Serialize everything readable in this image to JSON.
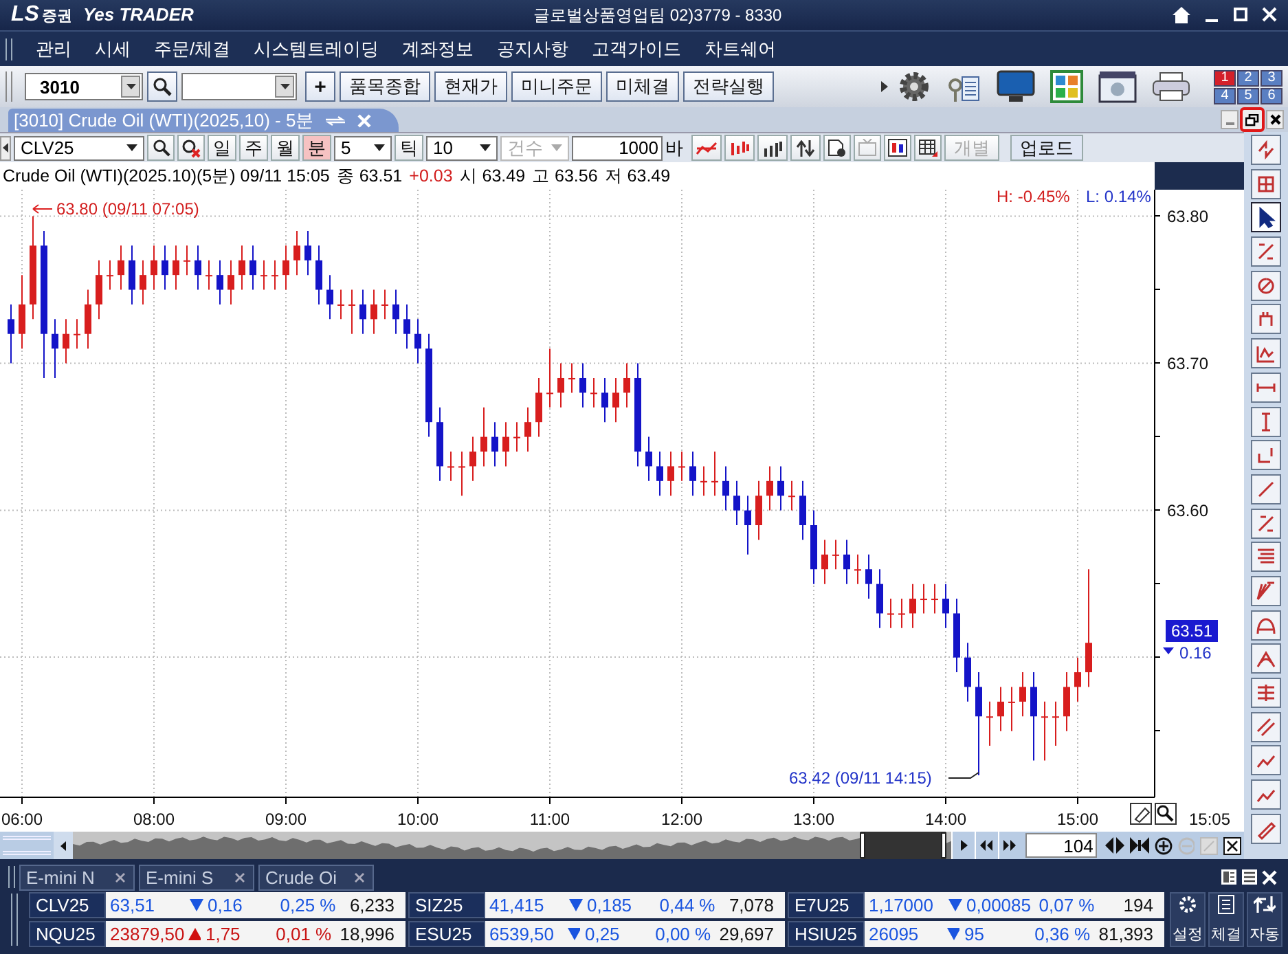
{
  "window": {
    "title": "글로벌상품영업팀 02)3779 - 8330"
  },
  "logo": {
    "brand": "LS",
    "sub": "증권",
    "product": "Yes TRADER"
  },
  "menu": [
    "관리",
    "시세",
    "주문/체결",
    "시스템트레이딩",
    "계좌정보",
    "공지사항",
    "고객가이드",
    "차트쉐어"
  ],
  "toolbar": {
    "screen_no": "3010",
    "plus": "+",
    "buttons": [
      "품목종합",
      "현재가",
      "미니주문",
      "미체결",
      "전략실행"
    ],
    "pages": [
      {
        "label": "1",
        "selected": true
      },
      {
        "label": "2",
        "selected": false
      },
      {
        "label": "3",
        "selected": false
      },
      {
        "label": "4",
        "selected": false
      },
      {
        "label": "5",
        "selected": false
      },
      {
        "label": "6",
        "selected": false
      }
    ]
  },
  "document_tab": {
    "title": "[3010] Crude Oil (WTI)(2025,10) - 5분"
  },
  "chart_toolbar": {
    "symbol": "CLV25",
    "periods": [
      {
        "label": "일",
        "selected": false
      },
      {
        "label": "주",
        "selected": false
      },
      {
        "label": "월",
        "selected": false
      },
      {
        "label": "분",
        "selected": true
      }
    ],
    "interval": "5",
    "tick_label": "틱",
    "tick_value": "10",
    "count_label": "건수",
    "bar_count": "1000",
    "bar_unit": "바",
    "separate": "개별",
    "upload": "업로드"
  },
  "chart": {
    "title": "Crude Oil (WTI)(2025.10)(5분) 09/11 15:05",
    "close_label": "종",
    "close": "63.51",
    "change": "+0.03",
    "open_label": "시",
    "open": "63.49",
    "high_label": "고",
    "high": "63.56",
    "low_label": "저",
    "low": "63.49",
    "high_pct": "H: -0.45%",
    "low_pct": "L: 0.14%",
    "max_note": "63.80 (09/11 07:05)",
    "min_note": "63.42 (09/11 14:15)",
    "last_time": "15:05",
    "current_price": "63.51",
    "current_change": "0.16",
    "chart_data": {
      "type": "candlestick",
      "grid": true,
      "ylim": [
        63.405,
        63.818
      ],
      "yticks": [
        {
          "value": 63.8,
          "label": "63.80"
        },
        {
          "value": 63.7,
          "label": "63.70"
        },
        {
          "value": 63.6,
          "label": "63.60"
        }
      ],
      "categories": [
        null,
        "06:00",
        null,
        null,
        null,
        null,
        null,
        null,
        null,
        null,
        null,
        null,
        null,
        "08:00",
        null,
        null,
        null,
        null,
        null,
        null,
        null,
        null,
        null,
        null,
        null,
        "09:00",
        null,
        null,
        null,
        null,
        null,
        null,
        null,
        null,
        null,
        null,
        null,
        "10:00",
        null,
        null,
        null,
        null,
        null,
        null,
        null,
        null,
        null,
        null,
        null,
        "11:00",
        null,
        null,
        null,
        null,
        null,
        null,
        null,
        null,
        null,
        null,
        null,
        "12:00",
        null,
        null,
        null,
        null,
        null,
        null,
        null,
        null,
        null,
        null,
        null,
        "13:00",
        null,
        null,
        null,
        null,
        null,
        null,
        null,
        null,
        null,
        null,
        null,
        "14:00",
        null,
        null,
        null,
        null,
        null,
        null,
        null,
        null,
        null,
        null,
        null,
        "15:00",
        null
      ],
      "ohlc": [
        [
          63.73,
          63.74,
          63.7,
          63.72
        ],
        [
          63.72,
          63.76,
          63.71,
          63.74
        ],
        [
          63.74,
          63.8,
          63.73,
          63.78
        ],
        [
          63.78,
          63.79,
          63.69,
          63.72
        ],
        [
          63.72,
          63.73,
          63.69,
          63.71
        ],
        [
          63.71,
          63.73,
          63.7,
          63.72
        ],
        [
          63.72,
          63.73,
          63.71,
          63.72
        ],
        [
          63.72,
          63.75,
          63.71,
          63.74
        ],
        [
          63.74,
          63.77,
          63.73,
          63.76
        ],
        [
          63.76,
          63.77,
          63.75,
          63.76
        ],
        [
          63.76,
          63.78,
          63.75,
          63.77
        ],
        [
          63.77,
          63.78,
          63.74,
          63.75
        ],
        [
          63.75,
          63.77,
          63.74,
          63.76
        ],
        [
          63.76,
          63.78,
          63.75,
          63.77
        ],
        [
          63.77,
          63.78,
          63.75,
          63.76
        ],
        [
          63.76,
          63.78,
          63.75,
          63.77
        ],
        [
          63.77,
          63.78,
          63.76,
          63.77
        ],
        [
          63.77,
          63.78,
          63.75,
          63.76
        ],
        [
          63.76,
          63.77,
          63.75,
          63.76
        ],
        [
          63.76,
          63.77,
          63.74,
          63.75
        ],
        [
          63.75,
          63.77,
          63.74,
          63.76
        ],
        [
          63.76,
          63.78,
          63.75,
          63.77
        ],
        [
          63.77,
          63.78,
          63.75,
          63.76
        ],
        [
          63.76,
          63.77,
          63.75,
          63.76
        ],
        [
          63.76,
          63.77,
          63.75,
          63.76
        ],
        [
          63.76,
          63.78,
          63.75,
          63.77
        ],
        [
          63.77,
          63.79,
          63.76,
          63.78
        ],
        [
          63.78,
          63.79,
          63.76,
          63.77
        ],
        [
          63.77,
          63.78,
          63.74,
          63.75
        ],
        [
          63.75,
          63.76,
          63.73,
          63.74
        ],
        [
          63.74,
          63.75,
          63.73,
          63.74
        ],
        [
          63.74,
          63.75,
          63.72,
          63.74
        ],
        [
          63.74,
          63.75,
          63.72,
          63.73
        ],
        [
          63.73,
          63.75,
          63.72,
          63.74
        ],
        [
          63.74,
          63.75,
          63.73,
          63.74
        ],
        [
          63.74,
          63.75,
          63.72,
          63.73
        ],
        [
          63.73,
          63.74,
          63.71,
          63.72
        ],
        [
          63.72,
          63.73,
          63.7,
          63.71
        ],
        [
          63.71,
          63.72,
          63.65,
          63.66
        ],
        [
          63.66,
          63.67,
          63.62,
          63.63
        ],
        [
          63.63,
          63.64,
          63.62,
          63.63
        ],
        [
          63.63,
          63.64,
          63.61,
          63.63
        ],
        [
          63.63,
          63.65,
          63.62,
          63.64
        ],
        [
          63.64,
          63.67,
          63.63,
          63.65
        ],
        [
          63.65,
          63.66,
          63.63,
          63.64
        ],
        [
          63.64,
          63.66,
          63.63,
          63.65
        ],
        [
          63.65,
          63.66,
          63.64,
          63.65
        ],
        [
          63.65,
          63.67,
          63.64,
          63.66
        ],
        [
          63.66,
          63.69,
          63.65,
          63.68
        ],
        [
          63.68,
          63.71,
          63.67,
          63.68
        ],
        [
          63.68,
          63.7,
          63.67,
          63.69
        ],
        [
          63.69,
          63.7,
          63.68,
          63.69
        ],
        [
          63.69,
          63.7,
          63.67,
          63.68
        ],
        [
          63.68,
          63.69,
          63.67,
          63.68
        ],
        [
          63.68,
          63.69,
          63.66,
          63.67
        ],
        [
          63.67,
          63.69,
          63.66,
          63.68
        ],
        [
          63.68,
          63.7,
          63.67,
          63.69
        ],
        [
          63.69,
          63.7,
          63.63,
          63.64
        ],
        [
          63.64,
          63.65,
          63.62,
          63.63
        ],
        [
          63.63,
          63.64,
          63.61,
          63.62
        ],
        [
          63.62,
          63.64,
          63.61,
          63.63
        ],
        [
          63.63,
          63.64,
          63.62,
          63.63
        ],
        [
          63.63,
          63.64,
          63.61,
          63.62
        ],
        [
          63.62,
          63.63,
          63.61,
          63.62
        ],
        [
          63.62,
          63.64,
          63.61,
          63.62
        ],
        [
          63.62,
          63.63,
          63.6,
          63.61
        ],
        [
          63.61,
          63.62,
          63.59,
          63.6
        ],
        [
          63.6,
          63.61,
          63.57,
          63.59
        ],
        [
          63.59,
          63.62,
          63.58,
          63.61
        ],
        [
          63.61,
          63.63,
          63.6,
          63.62
        ],
        [
          63.62,
          63.63,
          63.6,
          63.61
        ],
        [
          63.61,
          63.62,
          63.6,
          63.61
        ],
        [
          63.61,
          63.62,
          63.58,
          63.59
        ],
        [
          63.59,
          63.6,
          63.55,
          63.56
        ],
        [
          63.56,
          63.58,
          63.55,
          63.57
        ],
        [
          63.57,
          63.58,
          63.56,
          63.57
        ],
        [
          63.57,
          63.58,
          63.55,
          63.56
        ],
        [
          63.56,
          63.57,
          63.55,
          63.56
        ],
        [
          63.56,
          63.57,
          63.54,
          63.55
        ],
        [
          63.55,
          63.56,
          63.52,
          63.53
        ],
        [
          63.53,
          63.54,
          63.52,
          63.53
        ],
        [
          63.53,
          63.54,
          63.52,
          63.53
        ],
        [
          63.53,
          63.55,
          63.52,
          63.54
        ],
        [
          63.54,
          63.55,
          63.53,
          63.54
        ],
        [
          63.54,
          63.55,
          63.53,
          63.54
        ],
        [
          63.54,
          63.55,
          63.52,
          63.53
        ],
        [
          63.53,
          63.54,
          63.49,
          63.5
        ],
        [
          63.5,
          63.51,
          63.47,
          63.48
        ],
        [
          63.48,
          63.49,
          63.42,
          63.46
        ],
        [
          63.46,
          63.47,
          63.44,
          63.46
        ],
        [
          63.46,
          63.48,
          63.45,
          63.47
        ],
        [
          63.47,
          63.48,
          63.45,
          63.47
        ],
        [
          63.47,
          63.49,
          63.46,
          63.48
        ],
        [
          63.48,
          63.49,
          63.43,
          63.46
        ],
        [
          63.46,
          63.47,
          63.43,
          63.46
        ],
        [
          63.46,
          63.47,
          63.44,
          63.46
        ],
        [
          63.46,
          63.49,
          63.45,
          63.48
        ],
        [
          63.48,
          63.5,
          63.47,
          63.49
        ],
        [
          63.49,
          63.56,
          63.48,
          63.51
        ]
      ]
    }
  },
  "overview": {
    "bar_count": "104"
  },
  "watch_tabs": [
    "E-mini N",
    "E-mini S",
    "Crude Oi"
  ],
  "tickers": [
    {
      "symbol": "CLV25",
      "price": "63,51",
      "up": false,
      "change": "0,16",
      "pct": "0,25 %",
      "volume": "6,233"
    },
    {
      "symbol": "SIZ25",
      "price": "41,415",
      "up": false,
      "change": "0,185",
      "pct": "0,44 %",
      "volume": "7,078"
    },
    {
      "symbol": "E7U25",
      "price": "1,17000",
      "up": false,
      "change": "0,00085",
      "pct": "0,07 %",
      "volume": "194"
    },
    {
      "symbol": "NQU25",
      "price": "23879,50",
      "up": true,
      "change": "1,75",
      "pct": "0,01 %",
      "volume": "18,996"
    },
    {
      "symbol": "ESU25",
      "price": "6539,50",
      "up": false,
      "change": "0,25",
      "pct": "0,00 %",
      "volume": "29,697"
    },
    {
      "symbol": "HSIU25",
      "price": "26095",
      "up": false,
      "change": "95",
      "pct": "0,36 %",
      "volume": "81,393"
    }
  ],
  "side_buttons": [
    "설정",
    "체결",
    "자동"
  ]
}
